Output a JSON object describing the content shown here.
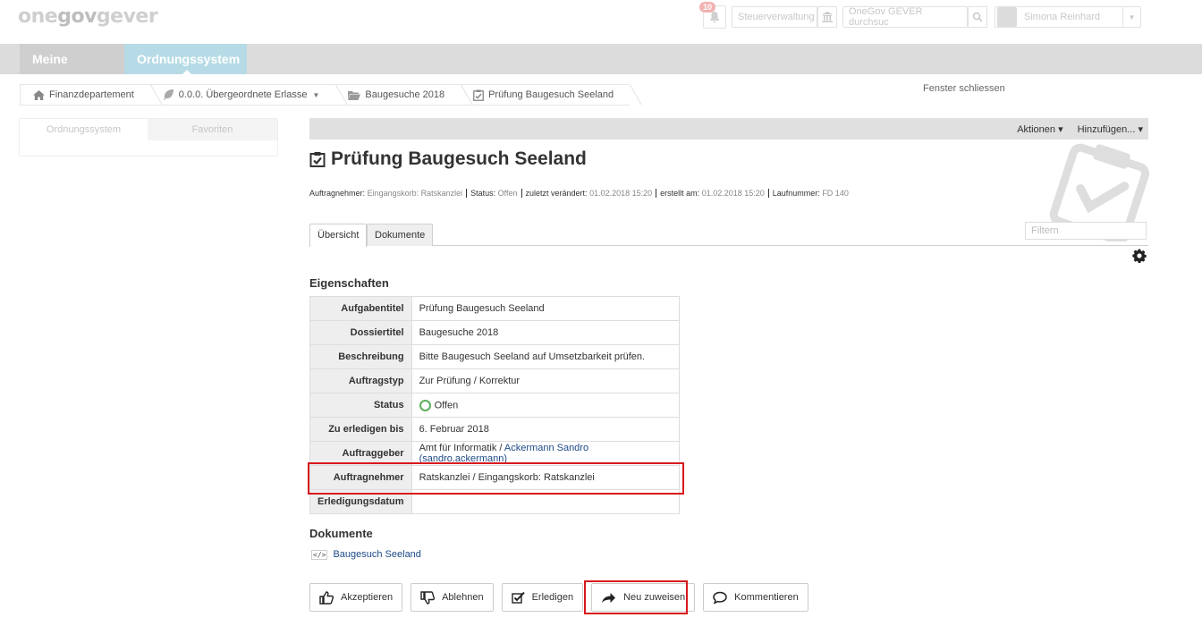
{
  "header": {
    "logo_a": "one",
    "logo_b": "gov",
    "logo_c": "gever",
    "notification_count": "10",
    "org_unit": "Steuerverwaltung",
    "search_placeholder": "OneGov GEVER durchsuc",
    "user_name": "Simona Reinhard"
  },
  "nav": {
    "tab1": "Meine Ablage",
    "tab2": "Ordnungssystem"
  },
  "breadcrumb": [
    "Finanzdepartement",
    "0.0.0. Übergeordnete Erlasse",
    "Baugesuche 2018",
    "Prüfung Baugesuch Seeland"
  ],
  "close_window": "Fenster schliessen",
  "portlet": {
    "tab1": "Ordnungssystem",
    "tab2": "Favoriten"
  },
  "actions": {
    "actions_label": "Aktionen ▾",
    "add_label": "Hinzufügen... ▾"
  },
  "title": "Prüfung Baugesuch Seeland",
  "meta": {
    "auftragnehmer_label": "Auftragnehmer:",
    "auftragnehmer_value": "Eingangskorb: Ratskanzlei",
    "status_label": "Status:",
    "status_value": "Offen",
    "changed_label": "zuletzt verändert:",
    "changed_value": "01.02.2018 15:20",
    "created_label": "erstellt am:",
    "created_value": "01.02.2018 15:20",
    "number_label": "Laufnummer:",
    "number_value": "FD 140"
  },
  "tabs": {
    "overview": "Übersicht",
    "documents": "Dokumente"
  },
  "filter_placeholder": "Filtern",
  "properties_heading": "Eigenschaften",
  "properties": {
    "aufgabentitel": {
      "label": "Aufgabentitel",
      "value": "Prüfung Baugesuch Seeland"
    },
    "dossiertitel": {
      "label": "Dossiertitel",
      "value": "Baugesuche 2018"
    },
    "beschreibung": {
      "label": "Beschreibung",
      "value": "Bitte Baugesuch Seeland auf Umsetzbarkeit prüfen."
    },
    "auftragstyp": {
      "label": "Auftragstyp",
      "value": "Zur Prüfung / Korrektur"
    },
    "status": {
      "label": "Status",
      "value": "Offen"
    },
    "deadline": {
      "label": "Zu erledigen bis",
      "value": "6. Februar 2018"
    },
    "auftraggeber": {
      "label": "Auftraggeber",
      "value_prefix": "Amt für Informatik / ",
      "value_link": "Ackermann Sandro (sandro.ackermann)"
    },
    "auftragnehmer": {
      "label": "Auftragnehmer",
      "value": "Ratskanzlei / Eingangskorb: Ratskanzlei"
    },
    "erledigungsdatum": {
      "label": "Erledigungsdatum",
      "value": ""
    }
  },
  "documents_heading": "Dokumente",
  "document_link": "Baugesuch Seeland",
  "buttons": {
    "accept": "Akzeptieren",
    "reject": "Ablehnen",
    "complete": "Erledigen",
    "reassign": "Neu zuweisen",
    "comment": "Kommentieren"
  },
  "colors": {
    "highlight": "#d8181c",
    "link": "#1b4a86",
    "nav_active": "#b6dbe6",
    "status_open": "#5ab05a"
  }
}
